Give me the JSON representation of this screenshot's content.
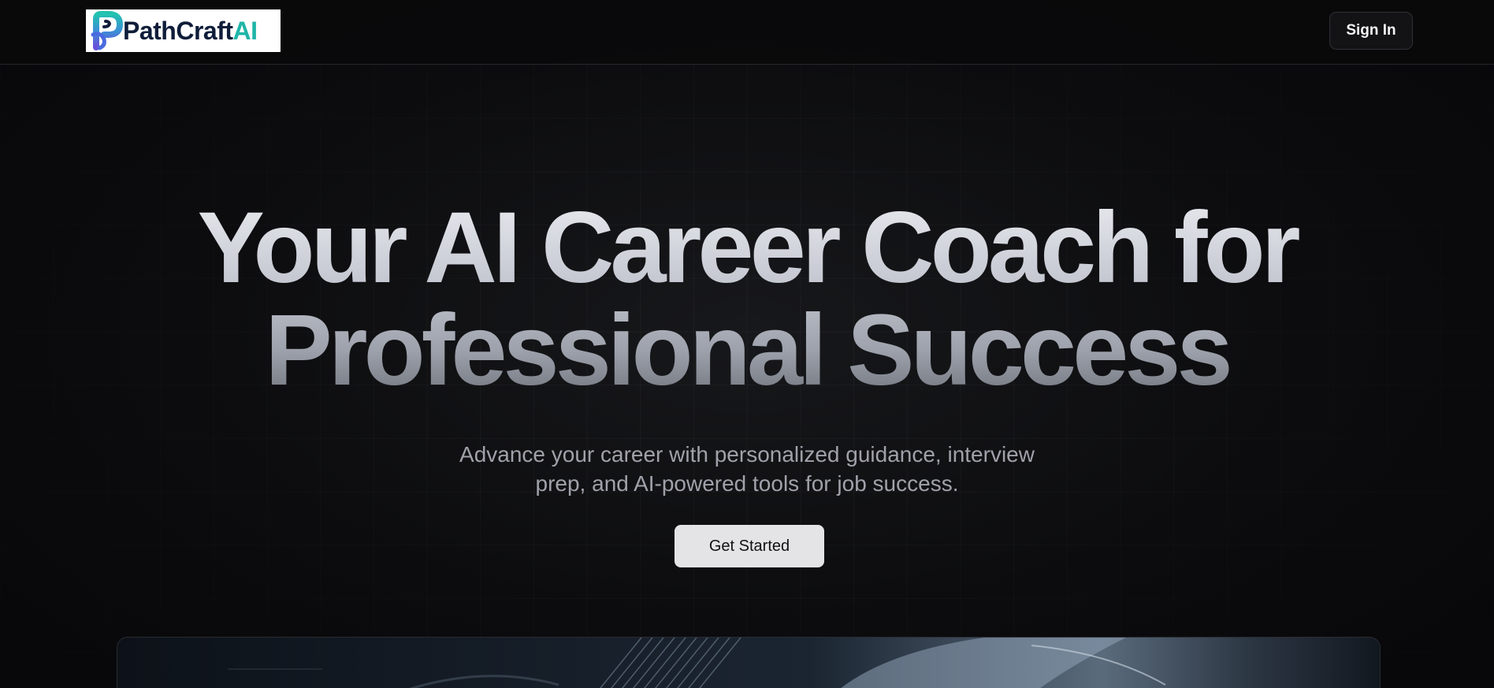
{
  "navbar": {
    "logo_text_main": "PathCraft",
    "logo_text_accent": "AI",
    "sign_in_label": "Sign In"
  },
  "hero": {
    "headline_line1": "Your AI Career Coach for",
    "headline_line2": "Professional Success",
    "subtitle": "Advance your career with personalized guidance, interview prep, and AI-powered tools for job success.",
    "cta_label": "Get Started"
  },
  "colors": {
    "background": "#0a0a0b",
    "logo_navy": "#0f1d3a",
    "logo_teal": "#1fb5a8",
    "logo_purple": "#6a4fd8",
    "cta_background": "#e4e4e7"
  },
  "icons": {
    "logo": "pathcraft-p-logo-icon"
  }
}
